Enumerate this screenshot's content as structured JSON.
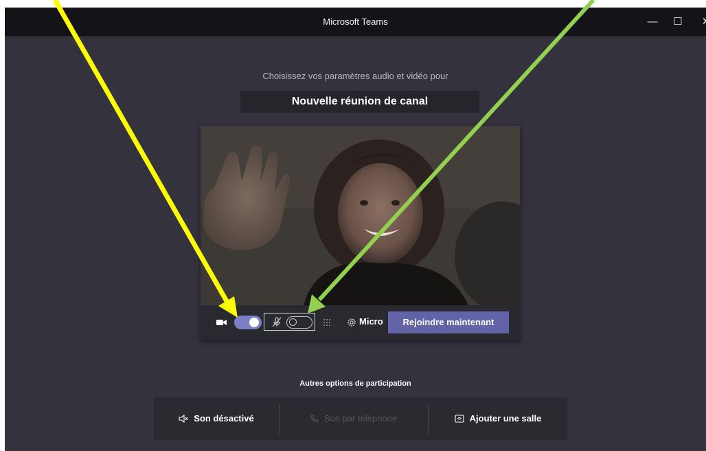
{
  "window": {
    "title": "Microsoft Teams",
    "controls": {
      "minimize": "—",
      "maximize": "☐",
      "close": "✕"
    }
  },
  "prejoin": {
    "prompt": "Choisissez vos paramètres audio et vidéo pour",
    "meeting_title": "Nouvelle réunion de canal",
    "device_label": "Micro",
    "join_label": "Rejoindre maintenant",
    "camera_on": true,
    "mic_on": false
  },
  "other_options": {
    "title": "Autres options de participation",
    "items": [
      {
        "label": "Son désactivé",
        "icon": "speaker-muted-icon",
        "enabled": true
      },
      {
        "label": "Son par téléphone",
        "icon": "phone-icon",
        "enabled": false
      },
      {
        "label": "Ajouter une salle",
        "icon": "room-icon",
        "enabled": true
      }
    ]
  },
  "colors": {
    "window_bg": "#33323d",
    "titlebar_bg": "#141318",
    "accent": "#6264a7",
    "toggle_on": "#7b7fc4",
    "arrow_yellow": "#ffff00",
    "arrow_green": "#92d050"
  },
  "annotations": [
    {
      "color": "yellow",
      "target": "camera-toggle"
    },
    {
      "color": "green",
      "target": "microphone-toggle"
    }
  ]
}
